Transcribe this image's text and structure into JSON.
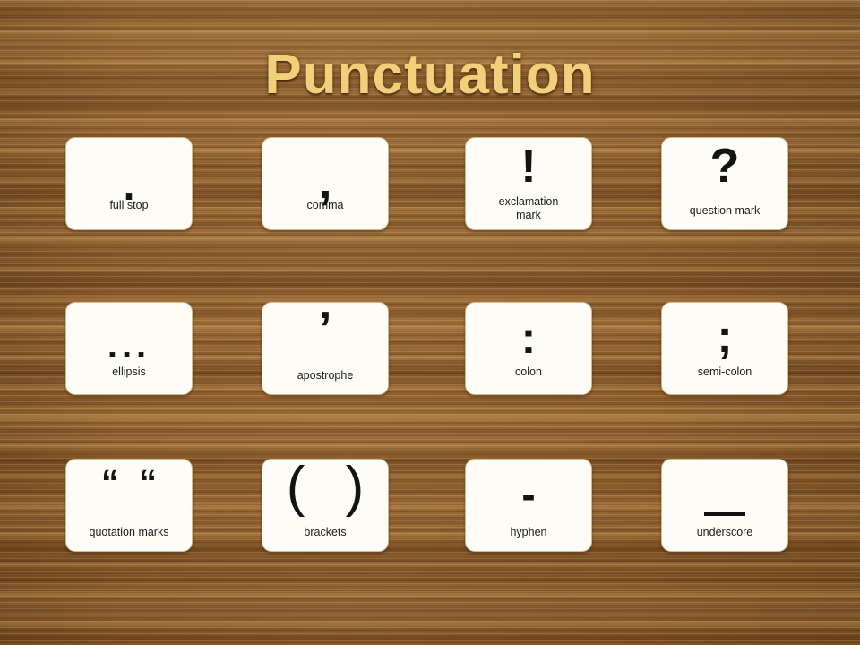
{
  "slide": {
    "title": "Punctuation",
    "title_color": "#f3cf7c",
    "background_color": "#8a5a2b",
    "card_color": "#fdfcf6",
    "card_border_color": "#cdbd8e",
    "glyph_color": "#131313"
  },
  "cards": [
    {
      "glyph": ".",
      "label": "full stop",
      "icon": "full-stop-glyph"
    },
    {
      "glyph": ",",
      "label": "comma",
      "icon": "comma-glyph"
    },
    {
      "glyph": "!",
      "label": "exclamation mark",
      "icon": "exclamation-mark-glyph"
    },
    {
      "glyph": "?",
      "label": "question mark",
      "icon": "question-mark-glyph"
    },
    {
      "glyph": "...",
      "label": "ellipsis",
      "icon": "ellipsis-glyph"
    },
    {
      "glyph": "’",
      "label": "apostrophe",
      "icon": "apostrophe-glyph"
    },
    {
      "glyph": ":",
      "label": "colon",
      "icon": "colon-glyph"
    },
    {
      "glyph": ";",
      "label": "semi-colon",
      "icon": "semi-colon-glyph"
    },
    {
      "glyph": "““",
      "label": "quotation marks",
      "icon": "quotation-marks-glyph"
    },
    {
      "glyph": "( )",
      "label": "brackets",
      "icon": "brackets-glyph"
    },
    {
      "glyph": "-",
      "label": "hyphen",
      "icon": "hyphen-glyph"
    },
    {
      "glyph": "—",
      "label": "underscore",
      "icon": "underscore-glyph"
    }
  ]
}
